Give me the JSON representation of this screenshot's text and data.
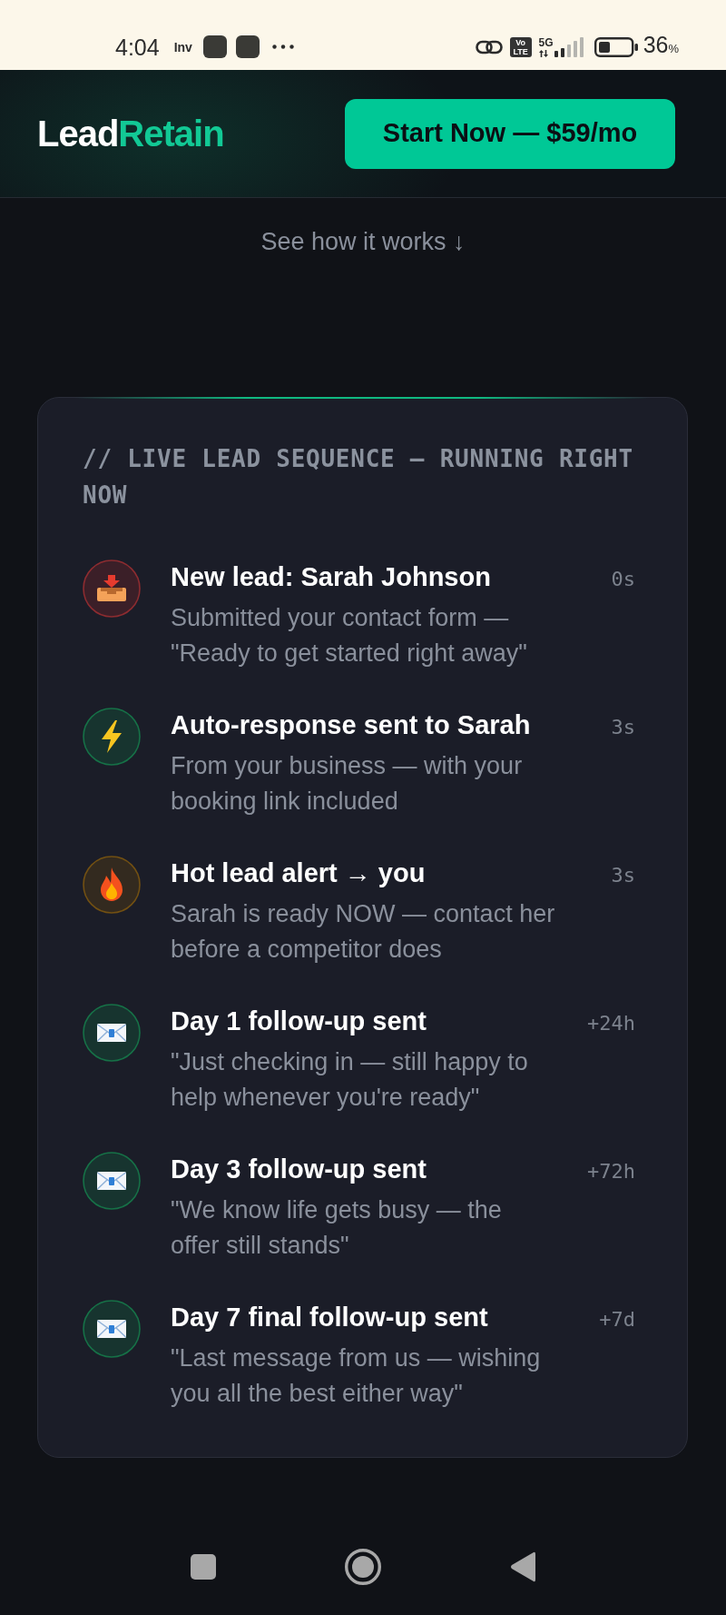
{
  "status_bar": {
    "time": "4:04",
    "notification": "Inv",
    "network_badge": [
      "Vo",
      "LTE"
    ],
    "network_type": "5G",
    "battery": "36",
    "battery_unit": "%"
  },
  "header": {
    "logo": {
      "first": "Lead",
      "second": "Retain"
    },
    "cta_button": "Start Now — $59/mo"
  },
  "see_how_link": "See how it works ↓",
  "sequence_card": {
    "title": "// LIVE LEAD SEQUENCE — RUNNING RIGHT NOW",
    "events": [
      {
        "kind": "inbox",
        "color": "#3b1f28",
        "title": "New lead: Sarah Johnson",
        "description": "Submitted your contact form — \"Ready to get started right away\"",
        "time": "0s"
      },
      {
        "kind": "bolt",
        "color": "#17342f",
        "title": "Auto-response sent to Sarah",
        "description": "From your business — with your booking link included",
        "time": "3s"
      },
      {
        "kind": "fire",
        "color": "#332a1f",
        "title": "Hot lead alert → you",
        "description": "Sarah is ready NOW — contact her before a competitor does",
        "time": "3s"
      },
      {
        "kind": "email",
        "color": "#17342f",
        "title": "Day 1 follow-up sent",
        "description": "\"Just checking in — still happy to help whenever you're ready\"",
        "time": "+24h"
      },
      {
        "kind": "email",
        "color": "#17342f",
        "title": "Day 3 follow-up sent",
        "description": "\"We know life gets busy — the offer still stands\"",
        "time": "+72h"
      },
      {
        "kind": "email",
        "color": "#17342f",
        "title": "Day 7 final follow-up sent",
        "description": "\"Last message from us — wishing you all the best either way\"",
        "time": "+7d"
      }
    ]
  }
}
